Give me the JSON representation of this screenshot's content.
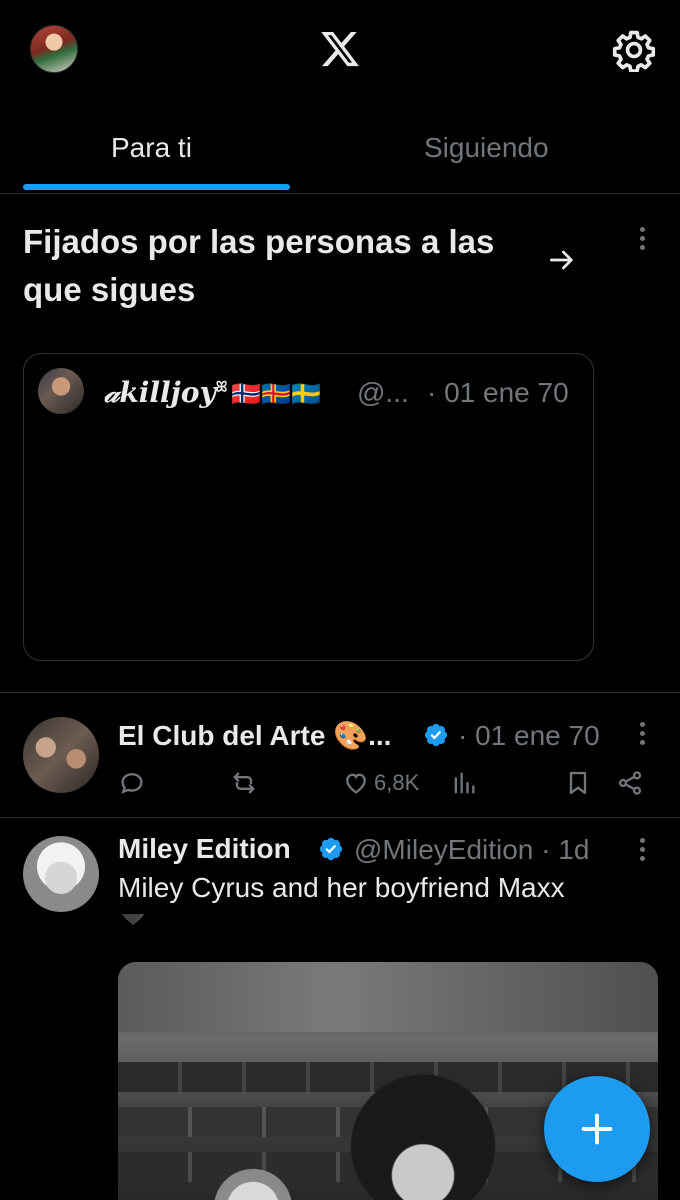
{
  "header": {
    "logo": "X",
    "icons": {
      "profile": "user-avatar",
      "settings": "gear-icon"
    }
  },
  "tabs": [
    {
      "label": "Para ti",
      "active": true
    },
    {
      "label": "Siguiendo",
      "active": false
    }
  ],
  "pinned_section": {
    "title": "Fijados por las personas a las que sigues",
    "card": {
      "name": "𝒶killjoy",
      "flags": "🇳🇴🇦🇽🇸🇪",
      "handle": "@...",
      "date": "· 01 ene 70"
    }
  },
  "posts": [
    {
      "name": "El Club del Arte 🎨...",
      "verified": true,
      "date": "· 01 ene 70",
      "likes": "6,8K"
    },
    {
      "name": "Miley Edition",
      "verified": true,
      "handle": "@MileyEdition",
      "time": "· 1d",
      "text": "Miley Cyrus and her boyfriend Maxx",
      "emoji": "🖤"
    }
  ],
  "colors": {
    "accent": "#1d9bf0",
    "muted": "#71767b",
    "border": "#2f3336"
  }
}
